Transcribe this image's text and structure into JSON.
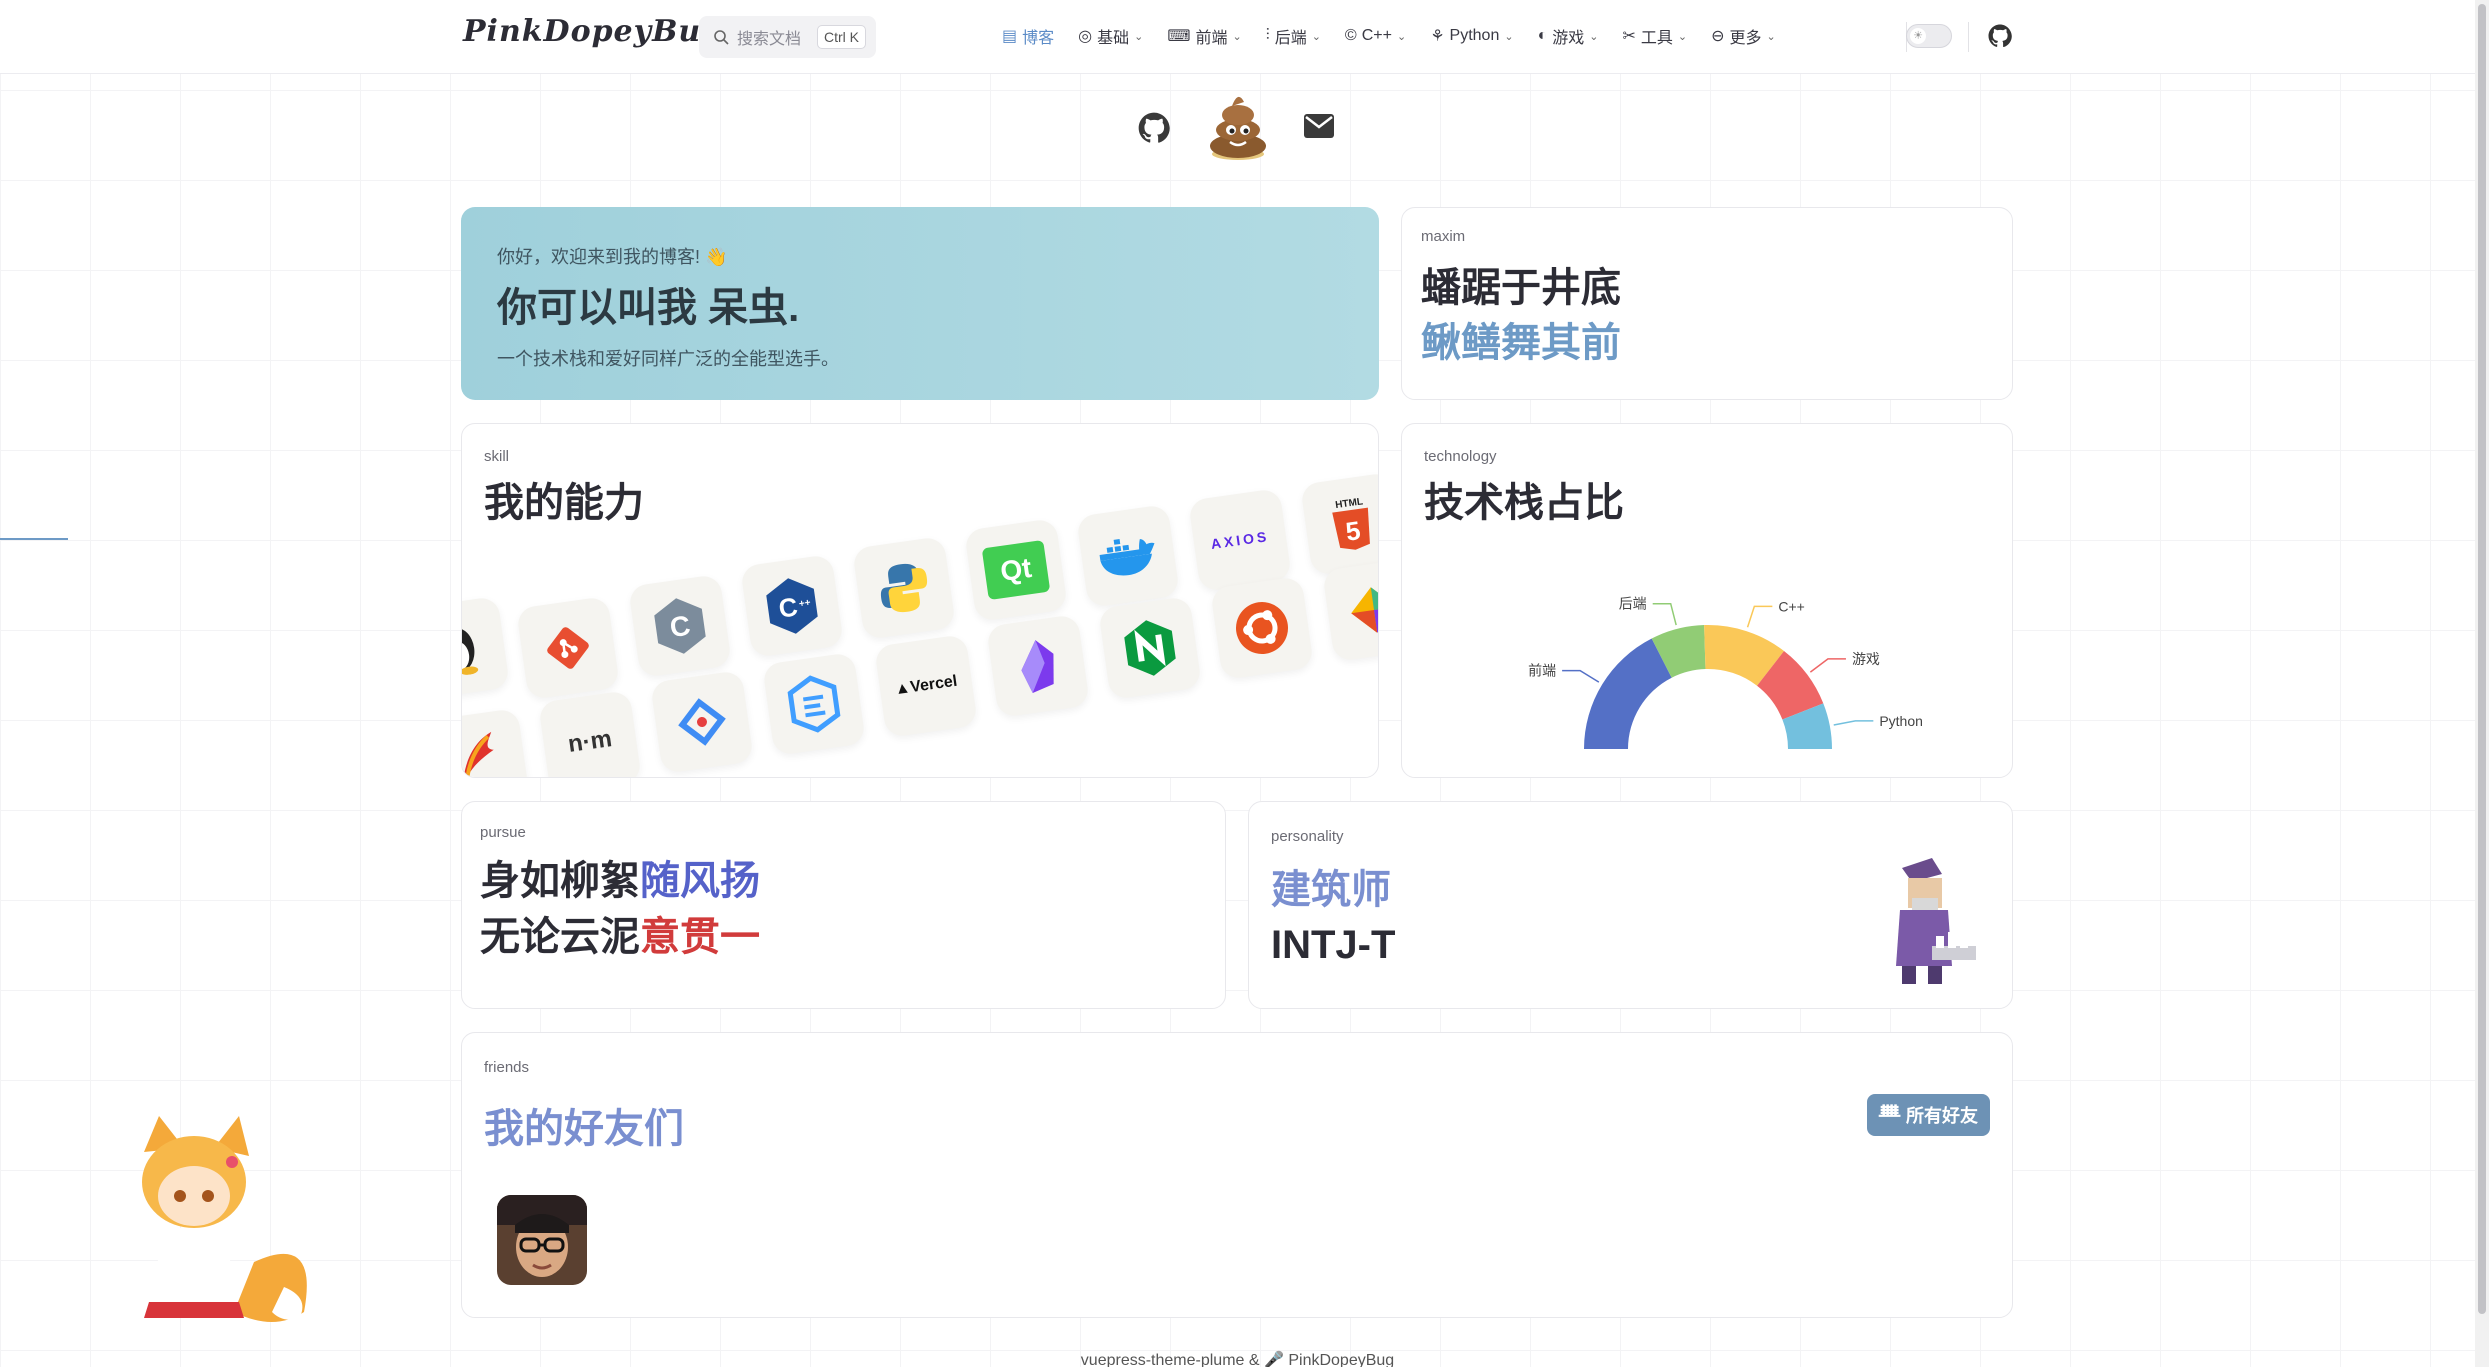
{
  "nav": {
    "logo": "PinkDopeyBug",
    "search_placeholder": "搜索文档",
    "search_shortcut": "Ctrl K",
    "items": [
      {
        "label": "博客",
        "icon": "doc-icon",
        "active": true,
        "has_dropdown": false
      },
      {
        "label": "基础",
        "icon": "target-icon",
        "has_dropdown": true
      },
      {
        "label": "前端",
        "icon": "terminal-icon",
        "has_dropdown": true
      },
      {
        "label": "后端",
        "icon": "sliders-icon",
        "has_dropdown": true
      },
      {
        "label": "C++",
        "icon": "cpp-icon",
        "has_dropdown": true
      },
      {
        "label": "Python",
        "icon": "python-icon",
        "has_dropdown": true
      },
      {
        "label": "游戏",
        "icon": "gamepad-icon",
        "has_dropdown": true
      },
      {
        "label": "工具",
        "icon": "tools-icon",
        "has_dropdown": true
      },
      {
        "label": "更多",
        "icon": "more-icon",
        "has_dropdown": true
      }
    ]
  },
  "welcome": {
    "greeting": "你好，欢迎来到我的博客! 👋",
    "name_prefix": "你可以叫我 ",
    "name": "呆虫",
    "name_suffix": ".",
    "subtitle": "一个技术栈和爱好同样广泛的全能型选手。"
  },
  "maxim": {
    "tag": "maxim",
    "line1": "蟠踞于井底",
    "line2": "鳅鳝舞其前"
  },
  "skill": {
    "tag": "skill",
    "title": "我的能力",
    "icons": [
      "linux-icon",
      "git-icon",
      "c-icon",
      "cplusplus-icon",
      "python-icon",
      "qt-icon",
      "docker-icon",
      "axios-icon",
      "html5-icon",
      "feather-icon",
      "nm-icon",
      "jetbrains-icon",
      "element-icon",
      "vercel-icon",
      "obsidian-icon",
      "nginx-icon",
      "ubuntu-icon",
      "four-color-icon"
    ],
    "axios_text": "AXIOS",
    "qt_text": "Qt",
    "html_text": "HTML",
    "vercel_text": "▲Vercel",
    "nm_text": "n·m"
  },
  "tech": {
    "tag": "technology",
    "title": "技术栈占比"
  },
  "chart_data": {
    "type": "pie",
    "style": "half-donut",
    "categories": [
      "前端",
      "后端",
      "C++",
      "游戏",
      "Python"
    ],
    "values": [
      35,
      14,
      22,
      17,
      12
    ],
    "colors": [
      "#5470c6",
      "#91cc75",
      "#fac858",
      "#ee6666",
      "#73c0de"
    ],
    "title": ""
  },
  "pursue": {
    "tag": "pursue",
    "line1_a": "身如柳絮",
    "line1_b": "随风扬",
    "line2_a": "无论云泥",
    "line2_b": "意贯一"
  },
  "personality": {
    "tag": "personality",
    "type_name": "建筑师",
    "code": "INTJ-T"
  },
  "friends": {
    "tag": "friends",
    "title": "我的好友们",
    "button": "所有好友"
  },
  "footer": {
    "text": "vuepress-theme-plume & 🎤 PinkDopeyBug"
  },
  "colors": {
    "accent": "#5b8bc7",
    "welcome_bg": "#a8d5de",
    "purple_text": "#7a8fd0",
    "red_text": "#d13b3b",
    "blue_text": "#5562c9"
  }
}
